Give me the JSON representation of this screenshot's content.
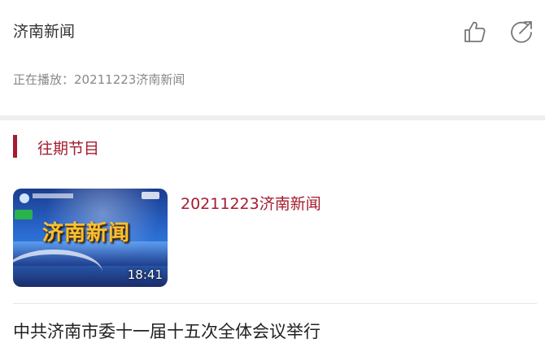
{
  "header": {
    "title": "济南新闻",
    "now_playing": "正在播放：20211223济南新闻",
    "icons": {
      "like": "thumbs-up-icon",
      "share": "share-icon"
    }
  },
  "section": {
    "title": "往期节目",
    "accent_color": "#a51c30"
  },
  "programs": [
    {
      "title": "20211223济南新闻",
      "duration": "18:41",
      "thumbnail_text": "济南新闻"
    }
  ],
  "next_item": {
    "title": "中共济南市委十一届十五次全体会议举行"
  }
}
